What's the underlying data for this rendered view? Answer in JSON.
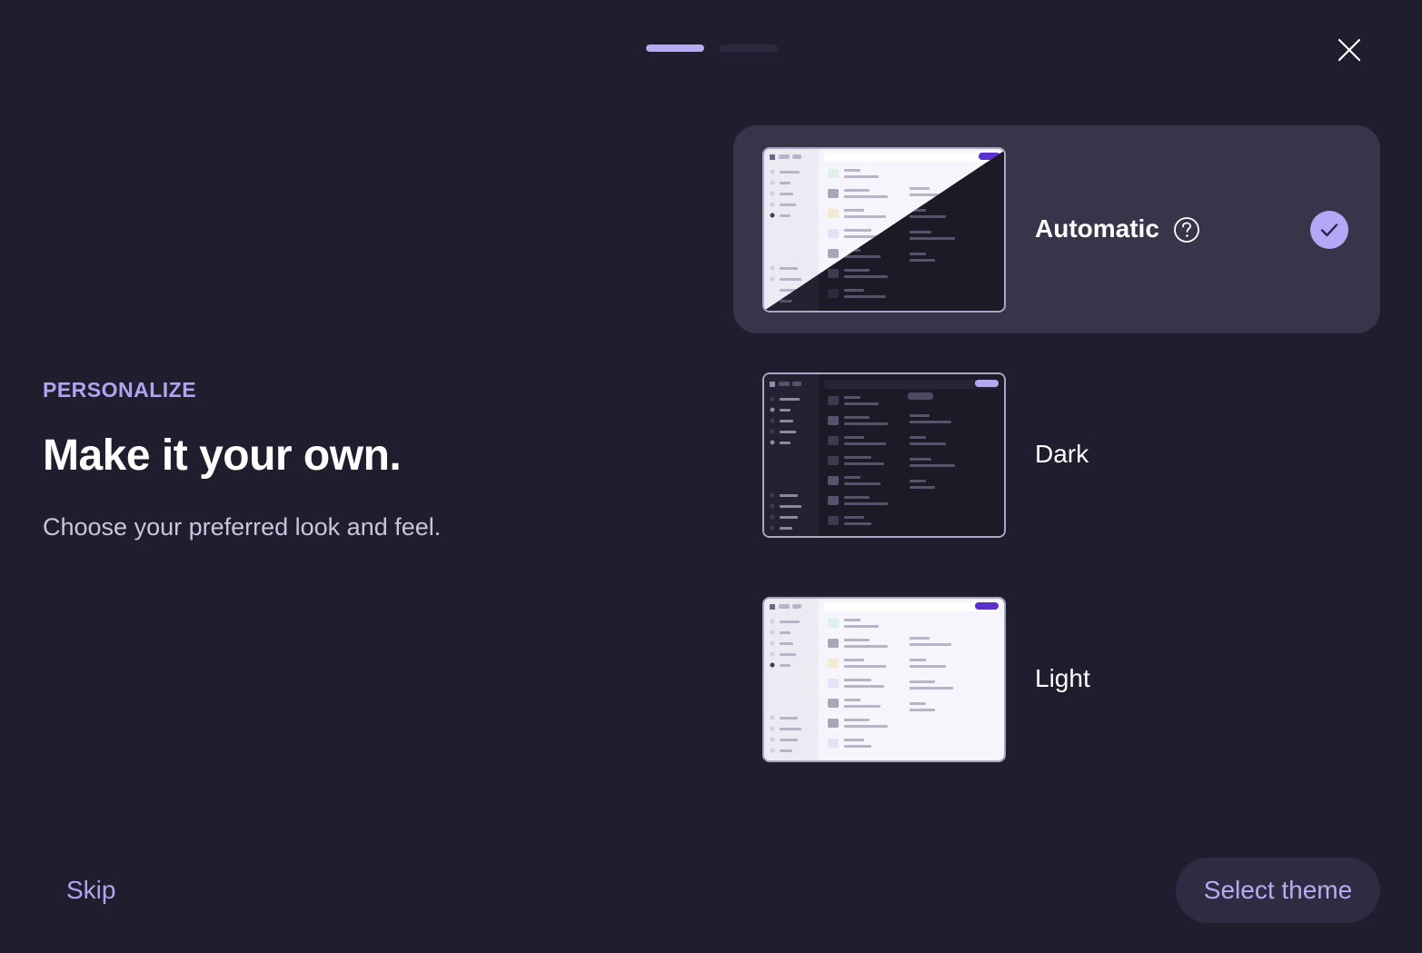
{
  "progress": {
    "total_steps": 2,
    "current_step": 1
  },
  "intro": {
    "eyebrow": "PERSONALIZE",
    "headline": "Make it your own.",
    "subheadline": "Choose your preferred look and feel."
  },
  "themes": [
    {
      "id": "automatic",
      "label": "Automatic",
      "selected": true,
      "has_help_icon": true
    },
    {
      "id": "dark",
      "label": "Dark",
      "selected": false,
      "has_help_icon": false
    },
    {
      "id": "light",
      "label": "Light",
      "selected": false,
      "has_help_icon": false
    }
  ],
  "actions": {
    "skip_label": "Skip",
    "primary_label": "Select theme"
  },
  "icons": {
    "close": "close-icon",
    "help": "help-circle-icon",
    "check": "check-icon"
  },
  "colors": {
    "background": "#1f1e2f",
    "accent": "#b7acf2",
    "selected_card": "#363549",
    "primary_button": "#2d2c42",
    "preview_brand": "#5b2fd0"
  }
}
